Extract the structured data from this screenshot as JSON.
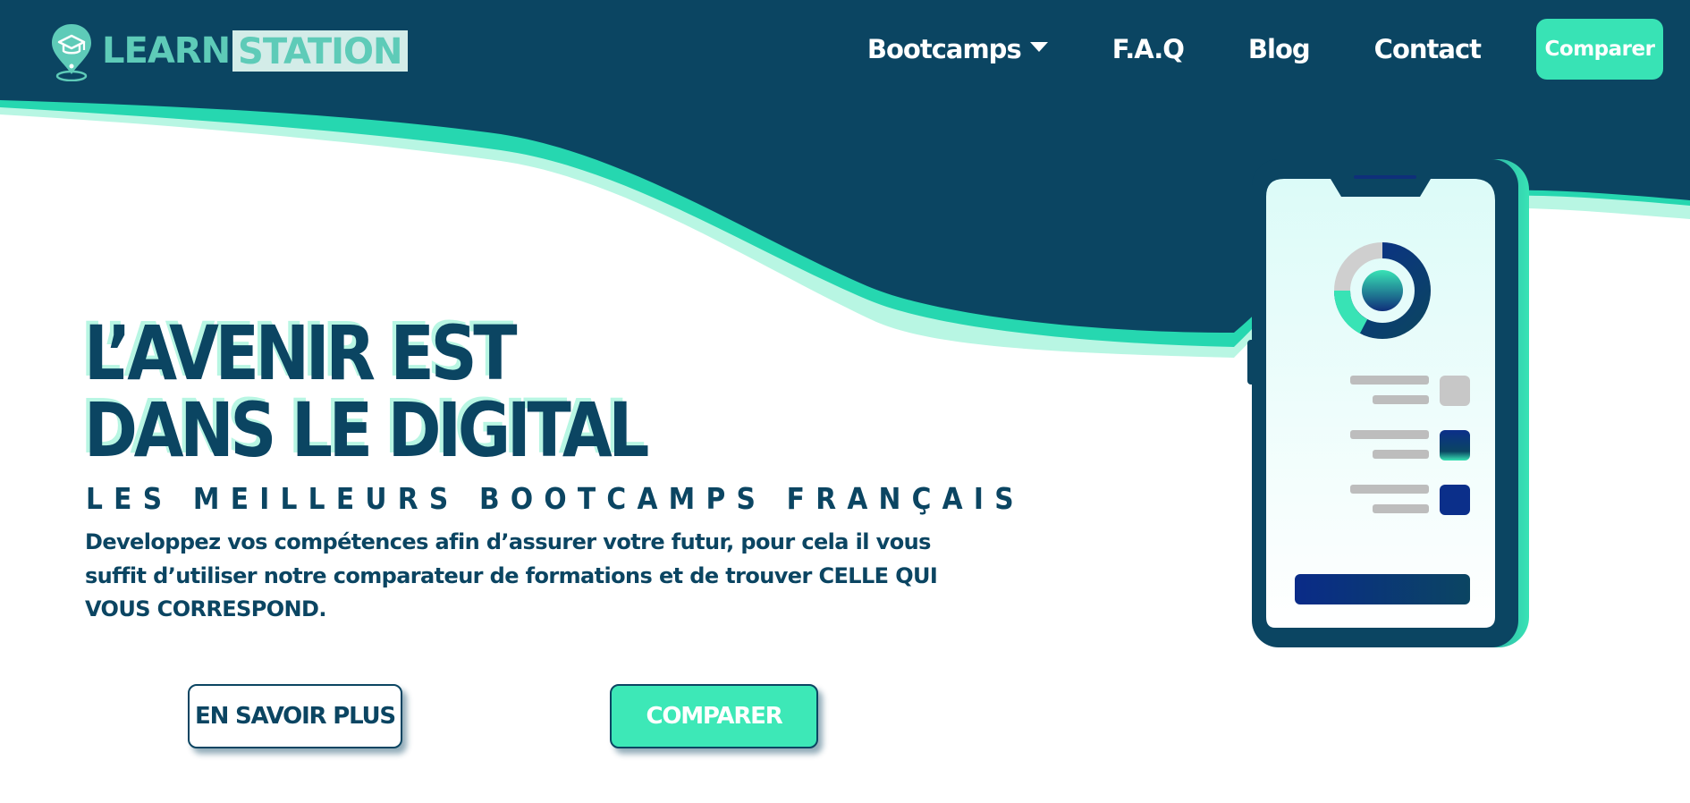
{
  "brand": {
    "name_part1": "LEARN",
    "name_part2": "STATION",
    "logo_icon": "graduation-cap-pin-icon"
  },
  "nav": {
    "items": [
      {
        "label": "Bootcamps",
        "has_dropdown": true
      },
      {
        "label": "F.A.Q"
      },
      {
        "label": "Blog"
      },
      {
        "label": "Contact"
      }
    ],
    "cta_label": "Comparer"
  },
  "hero": {
    "title_line1": "L’AVENIR EST",
    "title_line2": "DANS LE DIGITAL",
    "subtitle": "LES MEILLEURS BOOTCAMPS FRANÇAIS",
    "description": "Developpez vos compétences afin d’assurer votre futur, pour cela il vous suffit d’utiliser notre comparateur de formations et de trouver CELLE QUI VOUS CORRESPOND.",
    "primary_button": "EN SAVOIR PLUS",
    "secondary_button": "COMPARER"
  },
  "colors": {
    "navy": "#0b4562",
    "mint": "#38e3b5",
    "mint_light": "#b8f6e3",
    "white": "#ffffff"
  }
}
